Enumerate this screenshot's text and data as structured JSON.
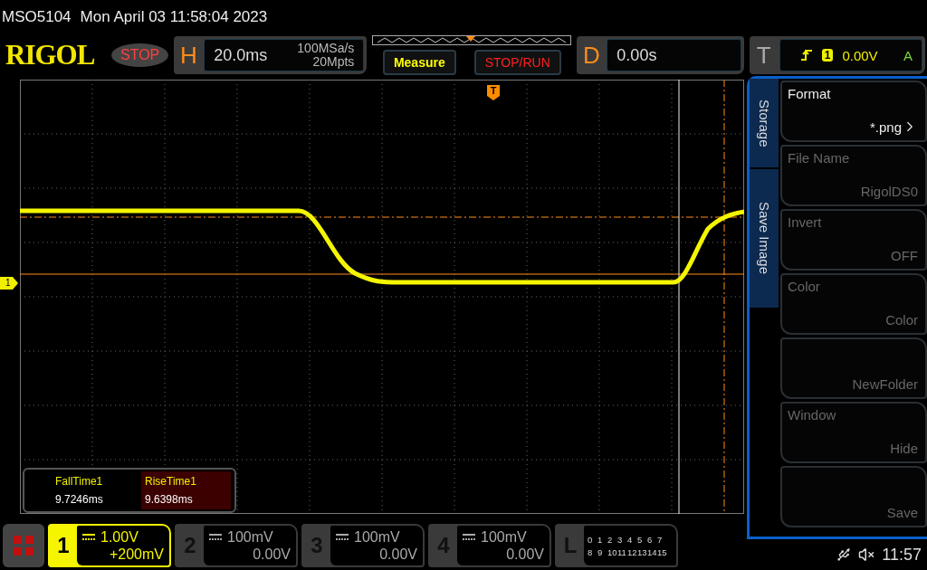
{
  "status_line": {
    "model": "MSO5104",
    "datetime": "Mon April 03 11:58:04 2023"
  },
  "header": {
    "logo": "RIGOL",
    "run_state": "STOP",
    "horizontal": {
      "letter": "H",
      "timebase": "20.0ms",
      "sample_rate": "100MSa/s",
      "memory_depth": "20Mpts"
    },
    "buttons": [
      {
        "label": "Measure",
        "kind": "measure"
      },
      {
        "label": "STOP/RUN",
        "kind": "run"
      }
    ],
    "delay": {
      "letter": "D",
      "value": "0.00s"
    },
    "trigger": {
      "letter": "T",
      "source": "1",
      "level": "0.00V",
      "mode": "A"
    }
  },
  "screen": {
    "channel_marker": "1",
    "trigger_marker": "T",
    "measurements": [
      {
        "label": "FallTime1",
        "value": "9.7246ms",
        "selected": false
      },
      {
        "label": "RiseTime1",
        "value": "9.6398ms",
        "selected": true
      }
    ]
  },
  "menu": {
    "tabs": [
      "Storage",
      "Save Image"
    ],
    "items": [
      {
        "label": "Format",
        "value": "*.png",
        "submenu": true,
        "disabled": false
      },
      {
        "label": "File Name",
        "value": "RigolDS0",
        "submenu": false,
        "disabled": true
      },
      {
        "label": "Invert",
        "value": "OFF",
        "submenu": false,
        "disabled": true
      },
      {
        "label": "Color",
        "value": "Color",
        "submenu": false,
        "disabled": true
      },
      {
        "value": "NewFolder",
        "submenu": false,
        "disabled": true
      },
      {
        "label": "Window",
        "value": "Hide",
        "submenu": false,
        "disabled": true
      },
      {
        "value": "Save",
        "submenu": false,
        "disabled": true
      }
    ]
  },
  "channels": [
    {
      "number": "1",
      "scale": "1.00V",
      "offset": "+200mV",
      "selected": true
    },
    {
      "number": "2",
      "scale": "100mV",
      "offset": "0.00V",
      "selected": false
    },
    {
      "number": "3",
      "scale": "100mV",
      "offset": "0.00V",
      "selected": false
    },
    {
      "number": "4",
      "scale": "100mV",
      "offset": "0.00V",
      "selected": false
    }
  ],
  "logic": {
    "letter": "L",
    "rows": [
      [
        "0",
        "1",
        "2",
        "3",
        "4",
        "5",
        "6",
        "7"
      ],
      [
        "8",
        "9",
        "10",
        "11",
        "12",
        "13",
        "14",
        "15"
      ]
    ]
  },
  "status": {
    "time": "11:57"
  }
}
